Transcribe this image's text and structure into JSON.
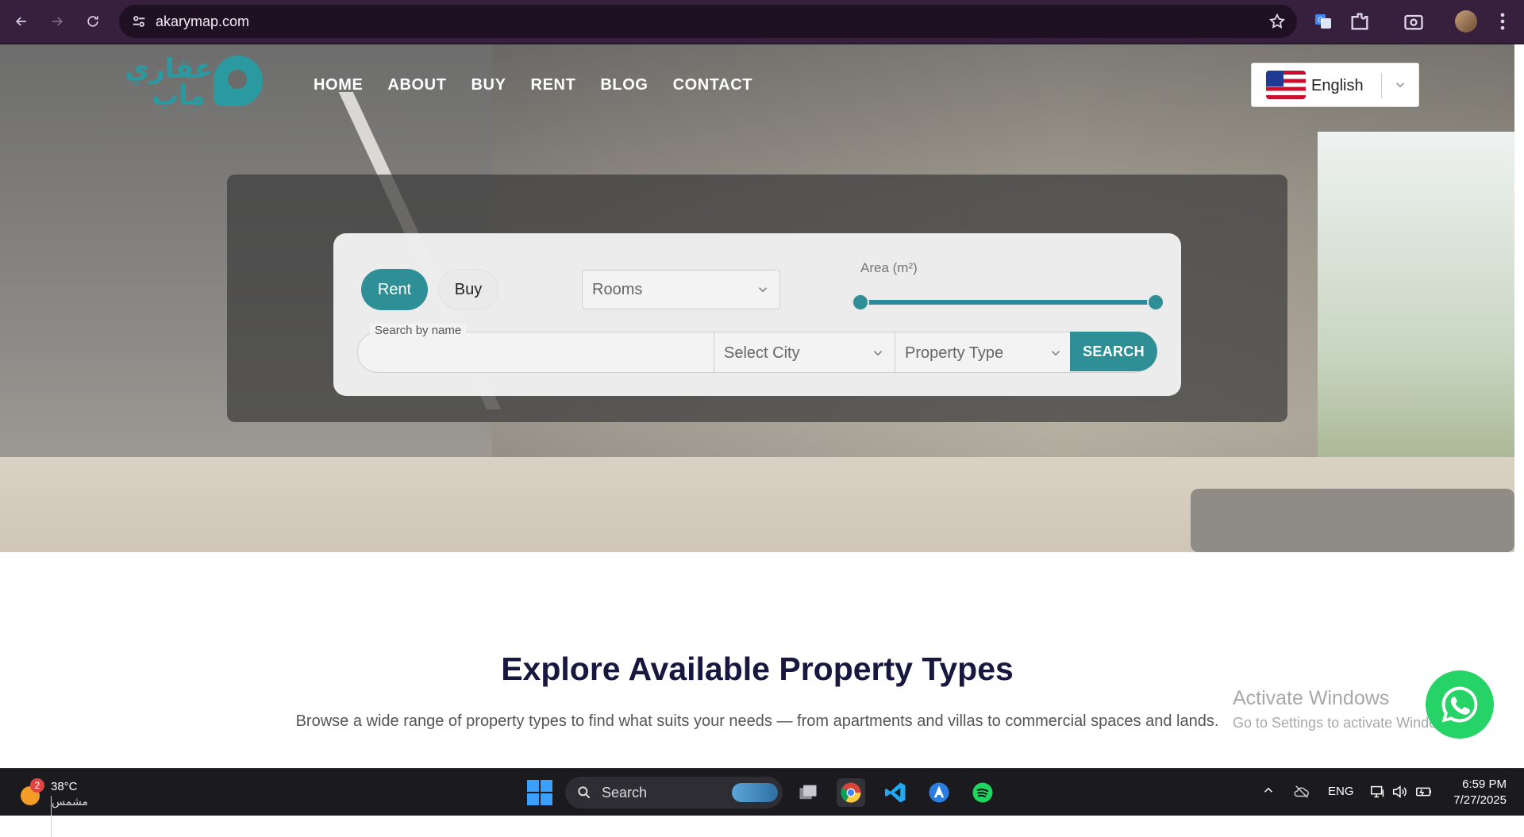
{
  "browser": {
    "url": "akarymap.com"
  },
  "site": {
    "logo_text": "عقاري ماب",
    "menu": [
      {
        "label": "HOME"
      },
      {
        "label": "ABOUT"
      },
      {
        "label": "BUY"
      },
      {
        "label": "RENT"
      },
      {
        "label": "BLOG"
      },
      {
        "label": "CONTACT"
      }
    ],
    "language": {
      "label": "English",
      "flag": "us-flag-icon"
    }
  },
  "search": {
    "mode_tabs": [
      {
        "label": "Rent",
        "active": true
      },
      {
        "label": "Buy",
        "active": false
      }
    ],
    "rooms_placeholder": "Rooms",
    "area_label": "Area (m²)",
    "name_label": "Search by name",
    "city_placeholder": "Select City",
    "property_type_placeholder": "Property Type",
    "search_button": "SEARCH",
    "accent_color": "#2f8f96"
  },
  "section": {
    "title": "Explore Available Property Types",
    "subtitle": "Browse a wide range of property types to find what suits your needs — from apartments and villas to commercial spaces and lands."
  },
  "watermark": {
    "line1": "Activate Windows",
    "line2": "Go to Settings to activate Windows."
  },
  "taskbar": {
    "weather_badge": "2",
    "temperature": "38°C",
    "weather_city": "مشمس",
    "search_label": "Search",
    "lang": "ENG",
    "time": "6:59 PM",
    "date": "7/27/2025"
  }
}
